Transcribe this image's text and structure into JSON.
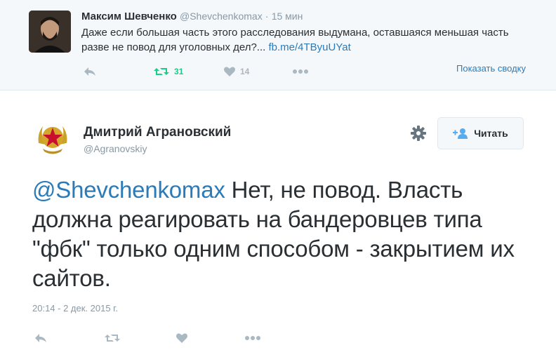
{
  "parent_tweet": {
    "author_name": "Максим Шевченко",
    "author_handle": "@Shevchenkomax",
    "separator": "·",
    "time": "15 мин",
    "text": "Даже если большая часть этого расследования выдумана, оставшаяся меньшая часть разве не повод для уголовных дел?...",
    "link": "fb.me/4TByuUYat",
    "retweet_count": "31",
    "like_count": "14",
    "summary_label": "Показать сводку",
    "colors": {
      "retweet": "#19cf86",
      "icon": "#aab8c2",
      "link": "#2b7bb9"
    }
  },
  "main_tweet": {
    "author_name": "Дмитрий Аграновский",
    "author_handle": "@Agranovskiy",
    "follow_label": "Читать",
    "mention": "@Shevchenkomax",
    "text": " Нет, не повод. Власть должна реагировать на бандеровцев типа \"фбк\" только одним способом - закрытием их сайтов.",
    "timestamp": "20:14 - 2 дек. 2015 г."
  },
  "icons": [
    "reply-icon",
    "retweet-icon",
    "like-icon",
    "more-icon",
    "gear-icon",
    "follow-user-icon",
    "star-emblem-icon"
  ]
}
